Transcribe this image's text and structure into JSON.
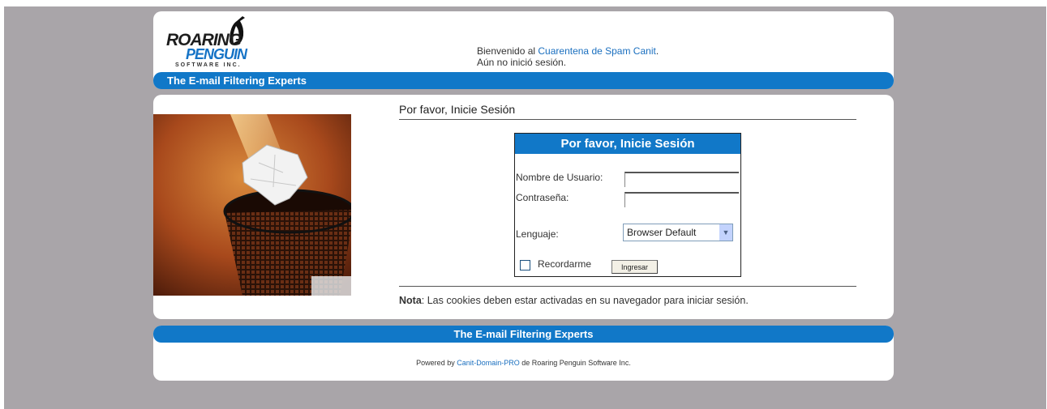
{
  "header": {
    "logo": {
      "line1": "ROARING",
      "line2": "PENGUIN",
      "line3": "SOFTWARE INC."
    },
    "tagline": "The E-mail Filtering Experts",
    "welcome_prefix": "Bienvenido al ",
    "welcome_link": "Cuarentena de Spam Canit",
    "welcome_suffix": ".",
    "status": "Aún no inició sesión."
  },
  "main": {
    "title": "Por favor, Inicie Sesión",
    "login": {
      "heading": "Por favor, Inicie Sesión",
      "username_label": "Nombre de Usuario:",
      "username_value": "",
      "password_label": "Contraseña:",
      "password_value": "",
      "language_label": "Lenguaje:",
      "language_value": "Browser Default",
      "remember_label": "Recordarme",
      "remember_checked": false,
      "submit_label": "Ingresar"
    },
    "note_bold": "Nota",
    "note_text": ": Las cookies deben estar activadas en su navegador para iniciar sesión."
  },
  "footer": {
    "tagline": "The E-mail Filtering Experts",
    "powered_prefix": "Powered by ",
    "powered_link": "Canit-Domain-PRO",
    "powered_suffix": " de Roaring Penguin Software Inc."
  },
  "colors": {
    "accent": "#1178c8",
    "link": "#1a6fbf",
    "background": "#a9a5a9"
  },
  "icons": {
    "logo": "roaring-penguin-logo",
    "dropdown": "chevron-down-icon"
  }
}
